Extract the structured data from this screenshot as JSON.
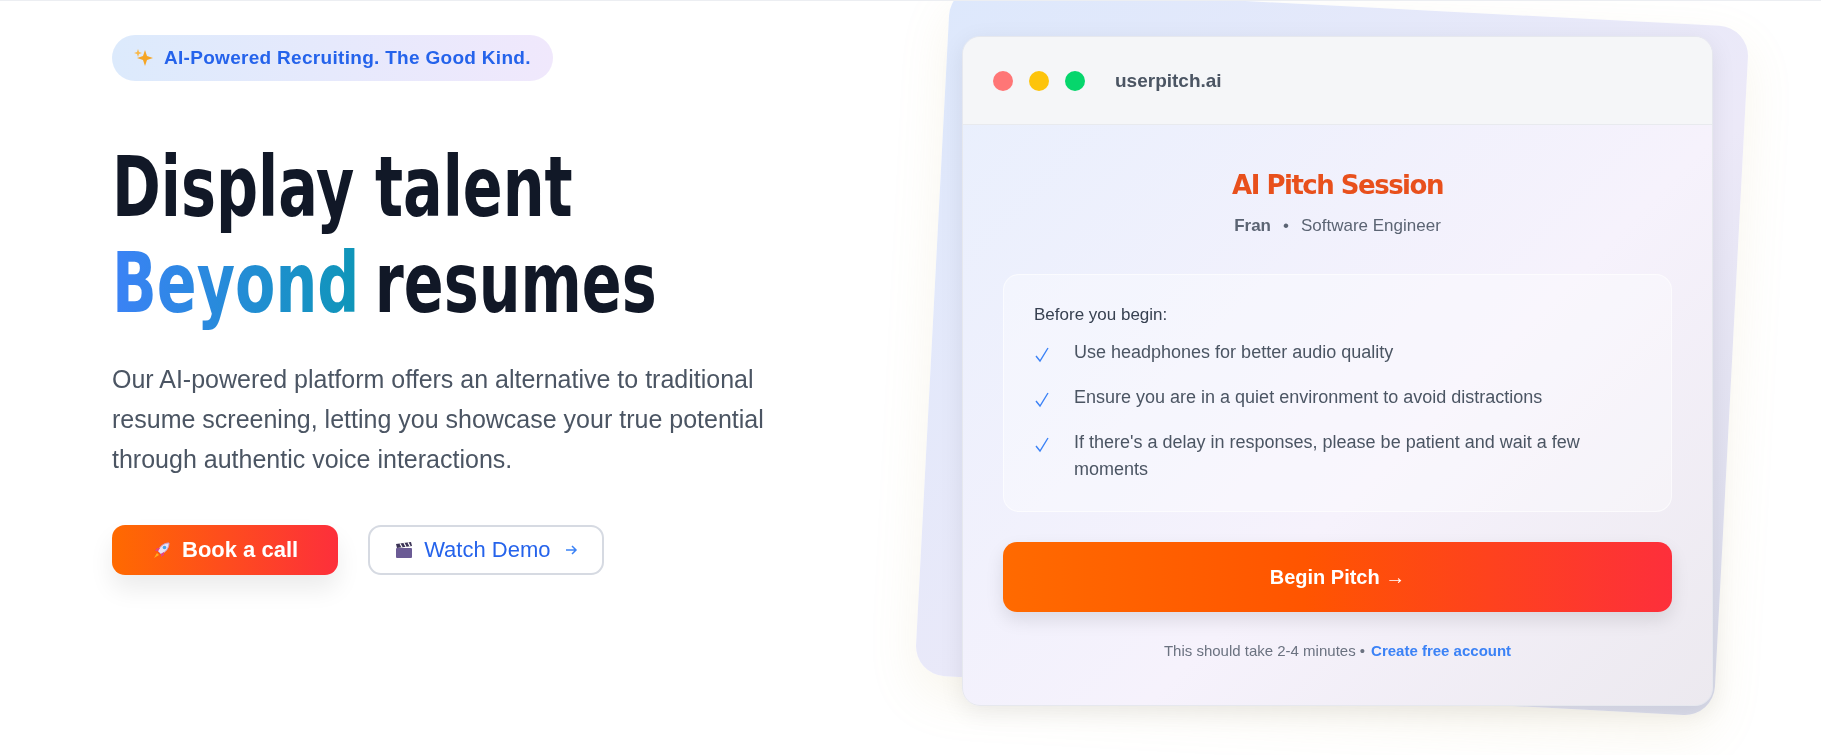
{
  "hero": {
    "badge": "AI-Powered Recruiting. The Good Kind.",
    "headline": [
      {
        "text": "Display talent",
        "kind": "plain"
      },
      {
        "text": "Beyond",
        "kind": "gradient"
      },
      {
        "text": "resumes",
        "kind": "plain"
      }
    ],
    "description": "Our AI-powered platform offers an alternative to traditional resume screening, letting you showcase your true potential through authentic voice interactions.",
    "buttons": [
      {
        "label": "Book a call",
        "kind": "primary"
      },
      {
        "label": "Watch Demo",
        "kind": "secondary"
      }
    ]
  },
  "preview": {
    "window": {
      "title": "userpitch.ai"
    },
    "heading": "AI Pitch Session",
    "name": "Fran",
    "separator": "•",
    "role": "Software Engineer",
    "checklist": {
      "title": "Before you begin:",
      "items": [
        "Use headphones for better audio quality",
        "Ensure you are in a quiet environment to avoid distractions",
        "If there's a delay in responses, please be patient and wait a few moments"
      ]
    },
    "button": "Begin Pitch →",
    "footer": {
      "text": "This should take 2-4 minutes •",
      "link": "Create free account"
    }
  }
}
